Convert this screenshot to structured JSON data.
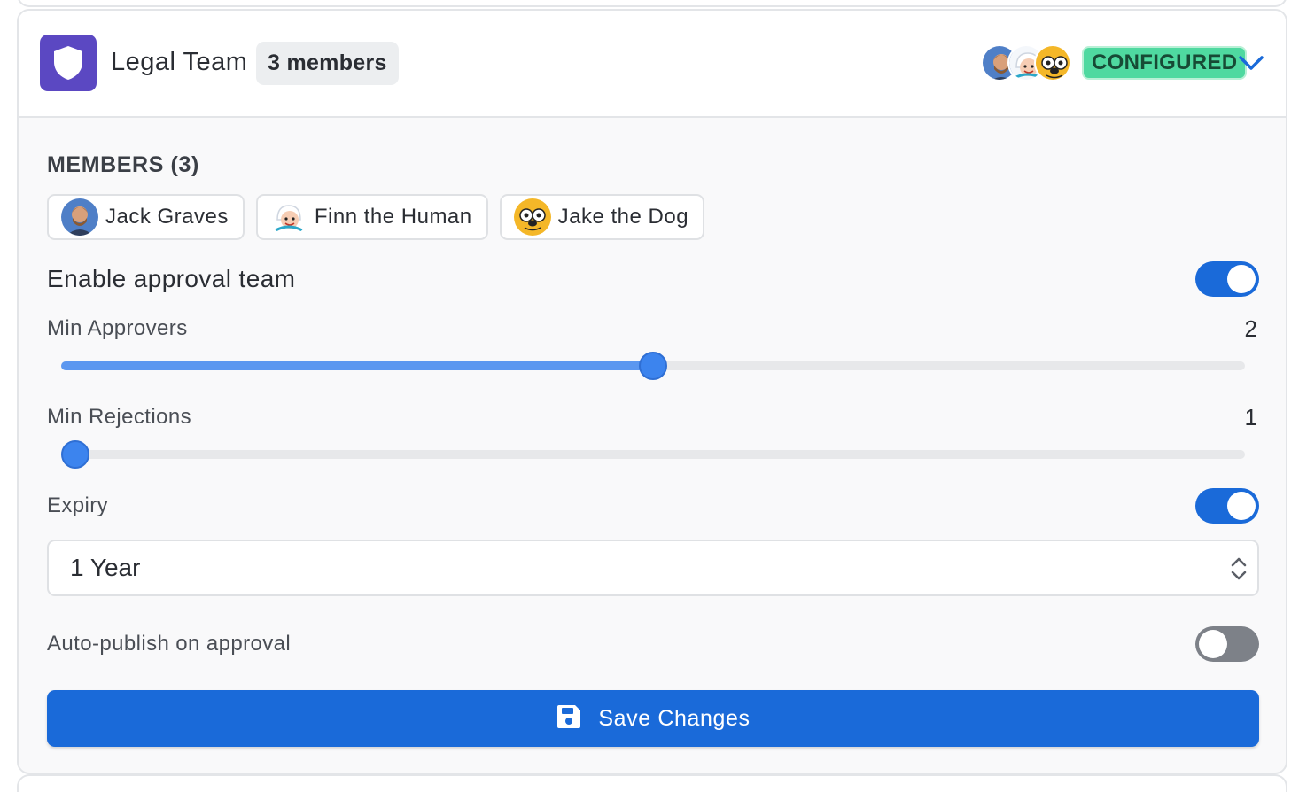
{
  "team": {
    "name": "Legal Team",
    "member_count": "3 members",
    "status": "CONFIGURED",
    "icon": "shield-icon"
  },
  "members_section": {
    "label": "MEMBERS (3)",
    "members": [
      {
        "name": "Jack Graves",
        "avatar": "jack-avatar"
      },
      {
        "name": "Finn the Human",
        "avatar": "finn-avatar"
      },
      {
        "name": "Jake the Dog",
        "avatar": "jake-avatar"
      }
    ]
  },
  "settings": {
    "enable_approval": {
      "label": "Enable approval team",
      "enabled": true
    },
    "min_approvers": {
      "label": "Min Approvers",
      "value": "2",
      "fill_fraction": 0.5
    },
    "min_rejections": {
      "label": "Min Rejections",
      "value": "1",
      "fill_fraction": 0.0
    },
    "expiry": {
      "label": "Expiry",
      "enabled": true,
      "selected": "1 Year"
    },
    "auto_publish": {
      "label": "Auto-publish on approval",
      "enabled": false
    }
  },
  "actions": {
    "save_label": "Save Changes",
    "save_icon": "floppy-disk-icon"
  },
  "colors": {
    "accent": "#1a6ad9",
    "team_icon_bg": "#5b48c2",
    "status_badge_bg": "#4fd9a0",
    "slider_fill": "#5b97f0"
  }
}
